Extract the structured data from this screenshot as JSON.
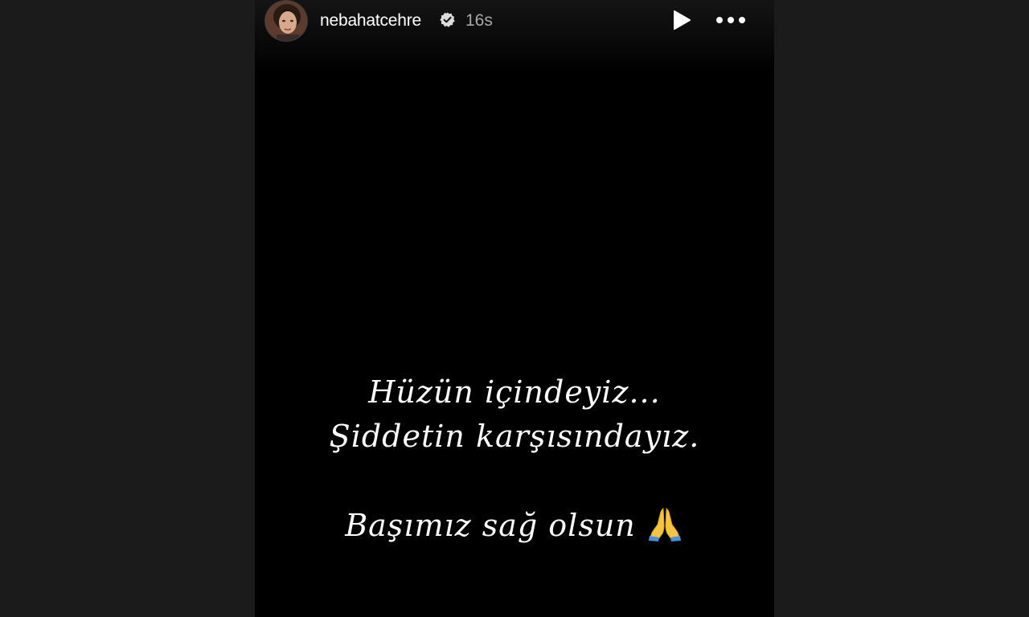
{
  "story": {
    "author": {
      "username": "nebahatcehre",
      "verified": true,
      "avatar": "avatar-photo",
      "posted_ago": "16s"
    },
    "controls": {
      "play_icon": "play-icon",
      "more_icon": "more-horizontal-icon"
    },
    "content": {
      "lines": [
        "Hüzün içindeyiz...",
        "Şiddetin karşısındayız.",
        "Başımız sağ olsun"
      ],
      "emoji": "folded-hands-emoji"
    }
  },
  "colors": {
    "page_background": "#1b1b1b",
    "story_background": "#000000",
    "text": "#ffffff",
    "timestamp": "#a8a8a8"
  }
}
